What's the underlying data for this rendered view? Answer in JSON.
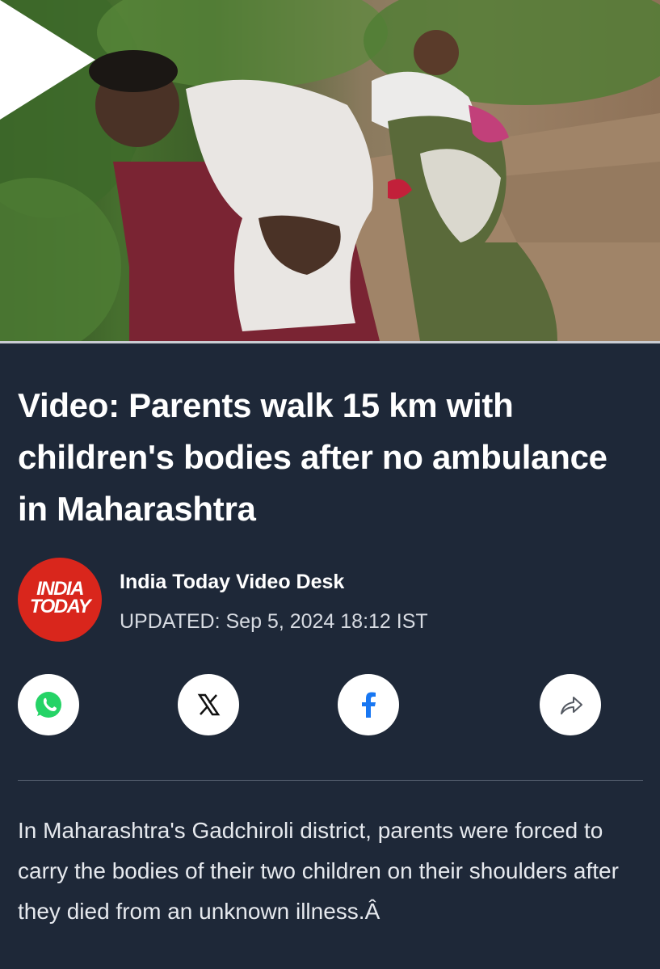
{
  "video": {
    "thumbnail_description_icon": "video-thumbnail",
    "play_icon": "play-icon"
  },
  "article": {
    "title": "Video: Parents walk 15 km with children's bodies after no ambulance in Maharashtra",
    "logo_text_line1": "INDIA",
    "logo_text_line2": "TODAY",
    "author": "India Today Video Desk",
    "updated": "UPDATED: Sep 5, 2024 18:12 IST",
    "body": "In Maharashtra's Gadchiroli district, parents were forced to carry the bodies of their two children on their shoulders after they died from an unknown illness.Â"
  },
  "share": {
    "icons": [
      "whatsapp-icon",
      "x-icon",
      "facebook-icon",
      "share-icon"
    ]
  },
  "colors": {
    "background": "#1e2838",
    "logo_red": "#d9261c",
    "facebook_blue": "#1877f2",
    "whatsapp_green": "#25d366"
  }
}
